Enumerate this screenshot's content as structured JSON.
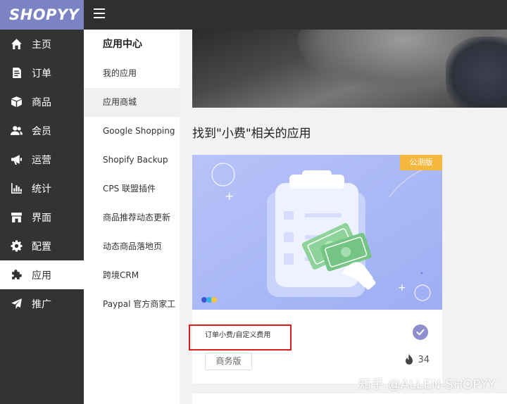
{
  "brand": {
    "logo_text": "SHOPYY"
  },
  "nav": {
    "items": [
      {
        "label": "主页",
        "icon": "home-icon"
      },
      {
        "label": "订单",
        "icon": "order-icon"
      },
      {
        "label": "商品",
        "icon": "box-icon"
      },
      {
        "label": "会员",
        "icon": "users-icon"
      },
      {
        "label": "运营",
        "icon": "megaphone-icon"
      },
      {
        "label": "统计",
        "icon": "chart-icon"
      },
      {
        "label": "界面",
        "icon": "store-icon"
      },
      {
        "label": "配置",
        "icon": "gear-icon"
      },
      {
        "label": "应用",
        "icon": "puzzle-icon"
      },
      {
        "label": "推广",
        "icon": "send-icon"
      }
    ],
    "active_index": 8
  },
  "submenu": {
    "title": "应用中心",
    "items": [
      "我的应用",
      "应用商城",
      "Google Shopping",
      "Shopify Backup",
      "CPS 联盟插件",
      "商品推荐动态更新",
      "动态商品落地页",
      "跨境CRM",
      "Paypal 官方商家工"
    ],
    "active_index": 1
  },
  "main": {
    "result_title": "找到\"小费\"相关的应用"
  },
  "card": {
    "tag": "公测版",
    "name": "订单小费/自定义费用",
    "edition": "商务版",
    "hot_count": "34"
  },
  "watermark": "知乎 @ALLEN-SHOPYY",
  "colors": {
    "sidebar_bg": "#333333",
    "logo_bg": "#7b83c4",
    "card_image_bg": "#aab7f5",
    "tag_bg": "#f5b73d",
    "highlight": "#e01d1d",
    "check": "#8f8fd0"
  }
}
